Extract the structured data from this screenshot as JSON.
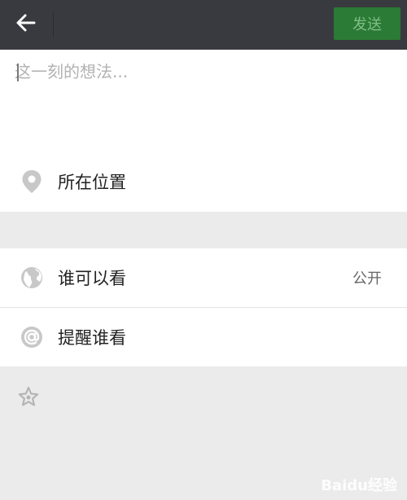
{
  "header": {
    "back_icon": "arrow-left-icon",
    "send_label": "发送",
    "colors": {
      "bar": "#393a3f",
      "send_bg": "#2b7a35",
      "send_text": "#7fbf88"
    }
  },
  "compose": {
    "placeholder": "这一刻的想法...",
    "value": ""
  },
  "location": {
    "icon": "location-pin-icon",
    "label": "所在位置"
  },
  "visibility": {
    "icon": "globe-icon",
    "label": "谁可以看",
    "value": "公开"
  },
  "mention": {
    "icon": "at-sign-icon",
    "label": "提醒谁看"
  },
  "extra": {
    "icon": "star-icon"
  },
  "watermark": {
    "text": "Baidu经验"
  }
}
